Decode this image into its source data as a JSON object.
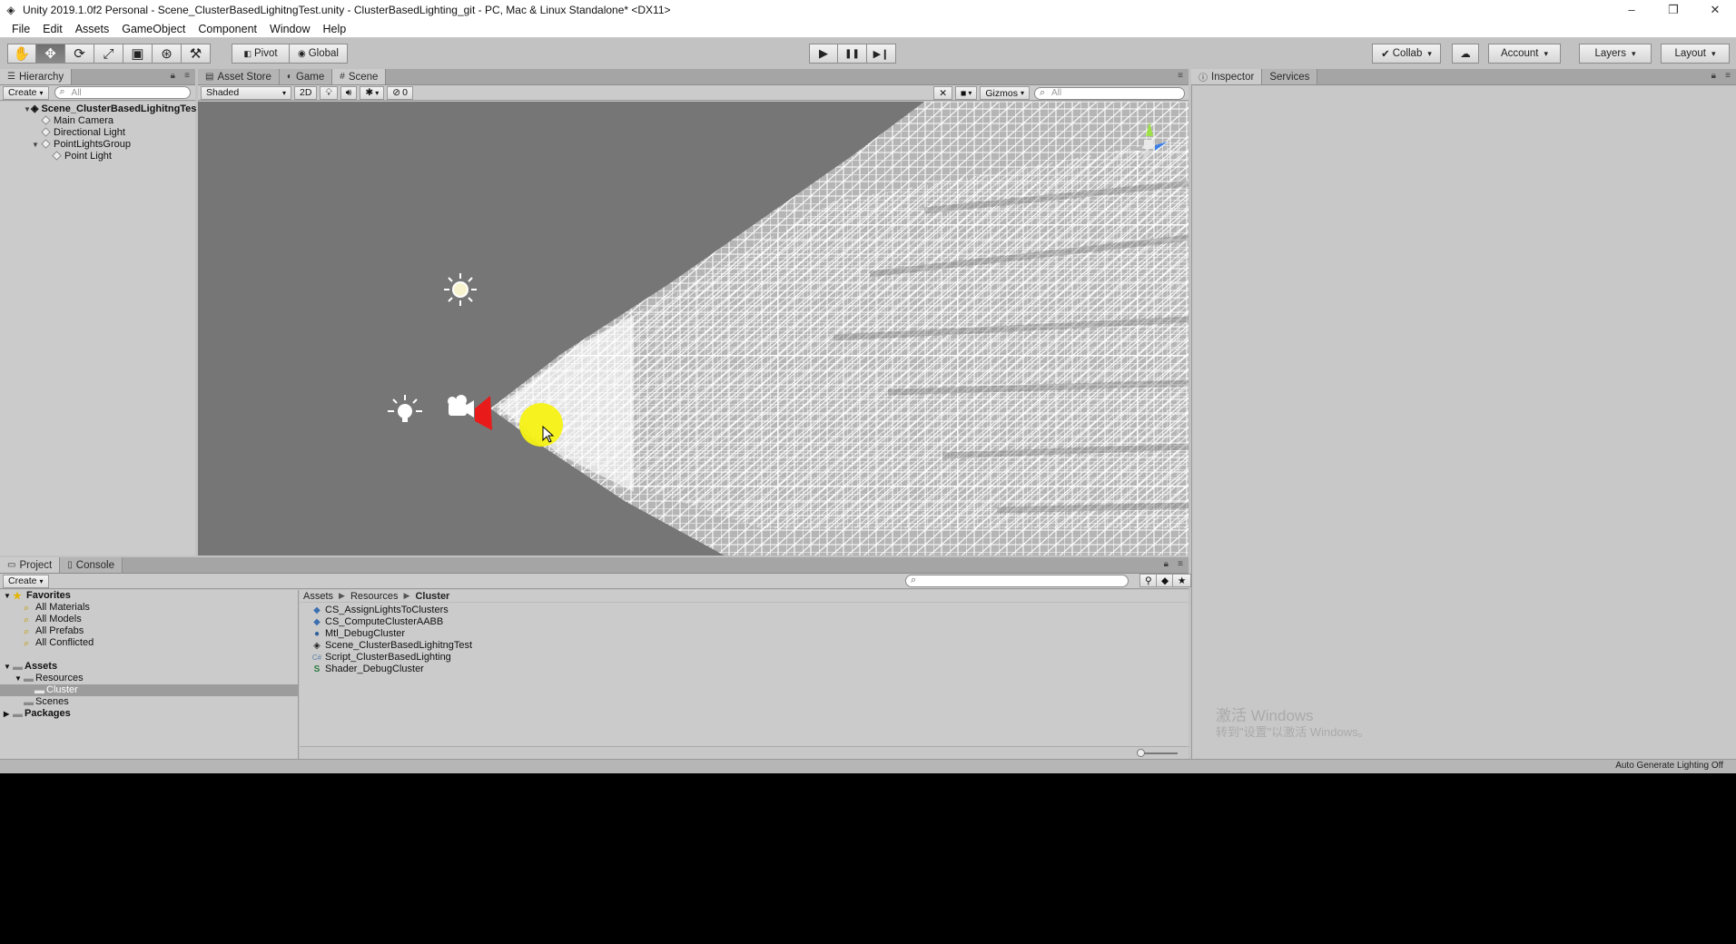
{
  "window": {
    "title": "Unity 2019.1.0f2 Personal - Scene_ClusterBasedLighitngTest.unity - ClusterBasedLighting_git - PC, Mac & Linux Standalone* <DX11>",
    "controls": [
      "–",
      "❐",
      "✕"
    ]
  },
  "menu": [
    "File",
    "Edit",
    "Assets",
    "GameObject",
    "Component",
    "Window",
    "Help"
  ],
  "toolbar": {
    "tools": [
      "hand-icon",
      "move-icon",
      "rotate-icon",
      "scale-icon",
      "rect-tool-icon",
      "transform-icon",
      "custom-tool-icon"
    ],
    "pivot_label": "Pivot",
    "global_label": "Global",
    "play_icon": "▶",
    "pause_icon": "❚❚",
    "step_icon": "▶❙",
    "collab_label": "Collab",
    "account_label": "Account",
    "layers_label": "Layers",
    "layout_label": "Layout"
  },
  "hierarchy": {
    "tab_label": "Hierarchy",
    "create_label": "Create",
    "search_placeholder": "All",
    "scene_name": "Scene_ClusterBasedLighitngTes",
    "items": [
      {
        "label": "Main Camera",
        "depth": 1
      },
      {
        "label": "Directional Light",
        "depth": 1
      },
      {
        "label": "PointLightsGroup",
        "depth": 1
      },
      {
        "label": "Point Light",
        "depth": 2
      }
    ]
  },
  "scene_view": {
    "tabs": [
      "Asset Store",
      "Game",
      "Scene"
    ],
    "active_tab": "Scene",
    "shading_mode": "Shaded",
    "mode_2d": "2D",
    "hidden_count": "0",
    "gizmos_label": "Gizmos",
    "search_placeholder": "All"
  },
  "inspector": {
    "tabs": [
      "Inspector",
      "Services"
    ],
    "watermark_line1": "激活 Windows",
    "watermark_line2": "转到\"设置\"以激活 Windows。"
  },
  "project": {
    "tabs": [
      "Project",
      "Console"
    ],
    "create_label": "Create",
    "favorites_label": "Favorites",
    "favorites": [
      "All Materials",
      "All Models",
      "All Prefabs",
      "All Conflicted"
    ],
    "assets_label": "Assets",
    "folders": [
      "Resources",
      "Cluster",
      "Scenes"
    ],
    "packages_label": "Packages",
    "breadcrumb": [
      "Assets",
      "Resources",
      "Cluster"
    ],
    "files": [
      {
        "name": "CS_AssignLightsToClusters",
        "icon": "compute-shader-icon"
      },
      {
        "name": "CS_ComputeClusterAABB",
        "icon": "compute-shader-icon"
      },
      {
        "name": "Mtl_DebugCluster",
        "icon": "material-icon"
      },
      {
        "name": "Scene_ClusterBasedLighitngTest",
        "icon": "unity-scene-icon"
      },
      {
        "name": "Script_ClusterBasedLighting",
        "icon": "csharp-script-icon"
      },
      {
        "name": "Shader_DebugCluster",
        "icon": "shader-icon"
      }
    ]
  },
  "status": {
    "text": "Auto Generate Lighting Off"
  },
  "colors": {
    "editor_bg": "#c2c2c2",
    "scene_bg": "#767676",
    "camera_near_plane": "#e81a1a",
    "point_light_gizmo": "#f5f214"
  }
}
